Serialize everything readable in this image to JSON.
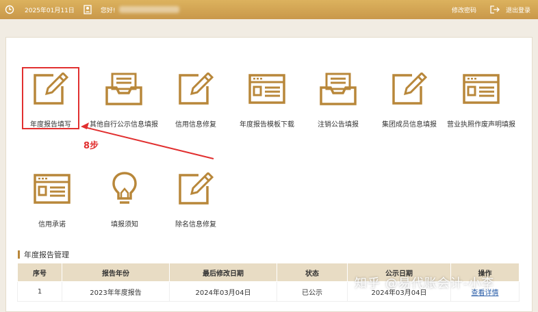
{
  "header": {
    "date": "2025年01月11日",
    "greeting": "您好!",
    "change_password": "修改密码",
    "logout": "退出登录"
  },
  "tiles": [
    {
      "label": "年度报告填写",
      "icon": "pencil-icon"
    },
    {
      "label": "其他自行公示信息填报",
      "icon": "inbox-icon"
    },
    {
      "label": "信用信息修复",
      "icon": "pencil-icon"
    },
    {
      "label": "年度报告模板下载",
      "icon": "window-icon"
    },
    {
      "label": "注销公告填报",
      "icon": "inbox-icon"
    },
    {
      "label": "集团成员信息填报",
      "icon": "pencil-icon"
    },
    {
      "label": "营业执照作废声明填报",
      "icon": "window-icon"
    },
    {
      "label": "信用承诺",
      "icon": "window-icon"
    },
    {
      "label": "填报须知",
      "icon": "lightbulb-icon"
    },
    {
      "label": "除名信息修复",
      "icon": "pencil-icon"
    }
  ],
  "annotation": {
    "text": "8步"
  },
  "section": {
    "title": "年度报告管理"
  },
  "table": {
    "headers": [
      "序号",
      "报告年份",
      "最后修改日期",
      "状态",
      "公示日期",
      "操作"
    ],
    "rows": [
      [
        "1",
        "2023年年度报告",
        "2024年03月04日",
        "已公示",
        "2024年03月04日",
        "查看详情"
      ]
    ]
  },
  "watermark": "知乎 @易代账会计-小李",
  "colors": {
    "header": "#d4a856",
    "icon": "#b8873a",
    "highlight": "#e12f2f"
  }
}
